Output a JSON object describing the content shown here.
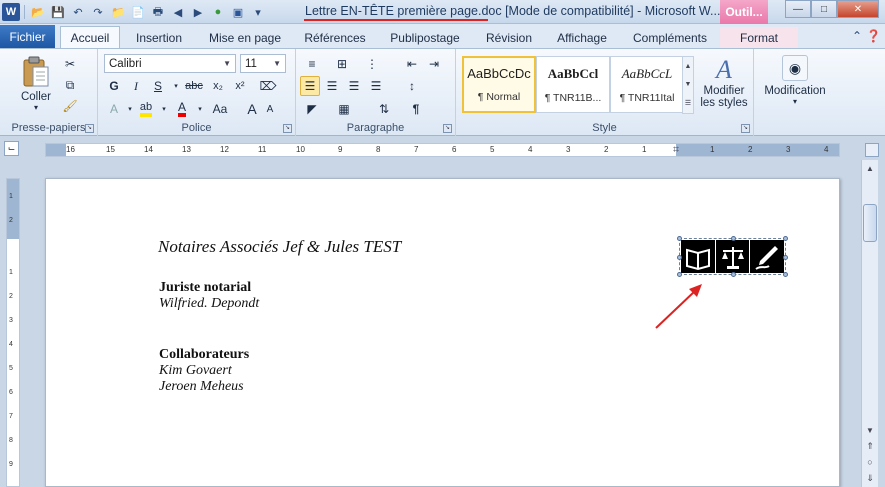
{
  "window": {
    "title": "Lettre EN-TÊTE première page.doc [Mode de compatibilité]  -  Microsoft W...",
    "context_tab_header": "Outil..."
  },
  "tabs": {
    "file": "Fichier",
    "items": [
      "Accueil",
      "Insertion",
      "Mise en page",
      "Références",
      "Publipostage",
      "Révision",
      "Affichage",
      "Compléments"
    ],
    "format": "Format"
  },
  "ribbon": {
    "clipboard": {
      "label": "Presse-papiers",
      "paste": "Coller"
    },
    "font": {
      "label": "Police",
      "font_name": "Calibri",
      "font_size": "11",
      "bold": "G",
      "italic": "I",
      "underline": "S",
      "strike": "abc",
      "subscript": "x₂",
      "superscript": "x²",
      "grow": "A",
      "shrink": "A"
    },
    "paragraph": {
      "label": "Paragraphe",
      "pilcrow": "¶"
    },
    "styles": {
      "label": "Style",
      "items": [
        {
          "sample": "AaBbCcDc",
          "name": "¶ Normal"
        },
        {
          "sample": "AaBbCcl",
          "name": "¶ TNR11B..."
        },
        {
          "sample": "AaBbCcL",
          "name": "¶ TNR11Ital"
        }
      ],
      "change_styles": "Modifier les styles"
    },
    "editing": {
      "label": "Modification"
    }
  },
  "ruler": {
    "ticks": [
      "16",
      "15",
      "14",
      "13",
      "12",
      "11",
      "10",
      "9",
      "8",
      "7",
      "6",
      "5",
      "4",
      "3",
      "2",
      "1",
      "1",
      "2",
      "3",
      "4"
    ],
    "vticks": [
      "1",
      "2",
      "1",
      "2",
      "3",
      "4",
      "5",
      "6",
      "7",
      "8",
      "9"
    ]
  },
  "document": {
    "title": "Notaires Associés Jef & Jules TEST",
    "section1_heading": "Juriste notarial",
    "section1_name": "Wilfried. Depondt",
    "section2_heading": "Collaborateurs",
    "section2_names": [
      "Kim Govaert",
      "Jeroen Meheus"
    ]
  },
  "colors": {
    "accent": "#2a5699",
    "annotation": "#d22222",
    "format_tab": "#e978aa"
  }
}
